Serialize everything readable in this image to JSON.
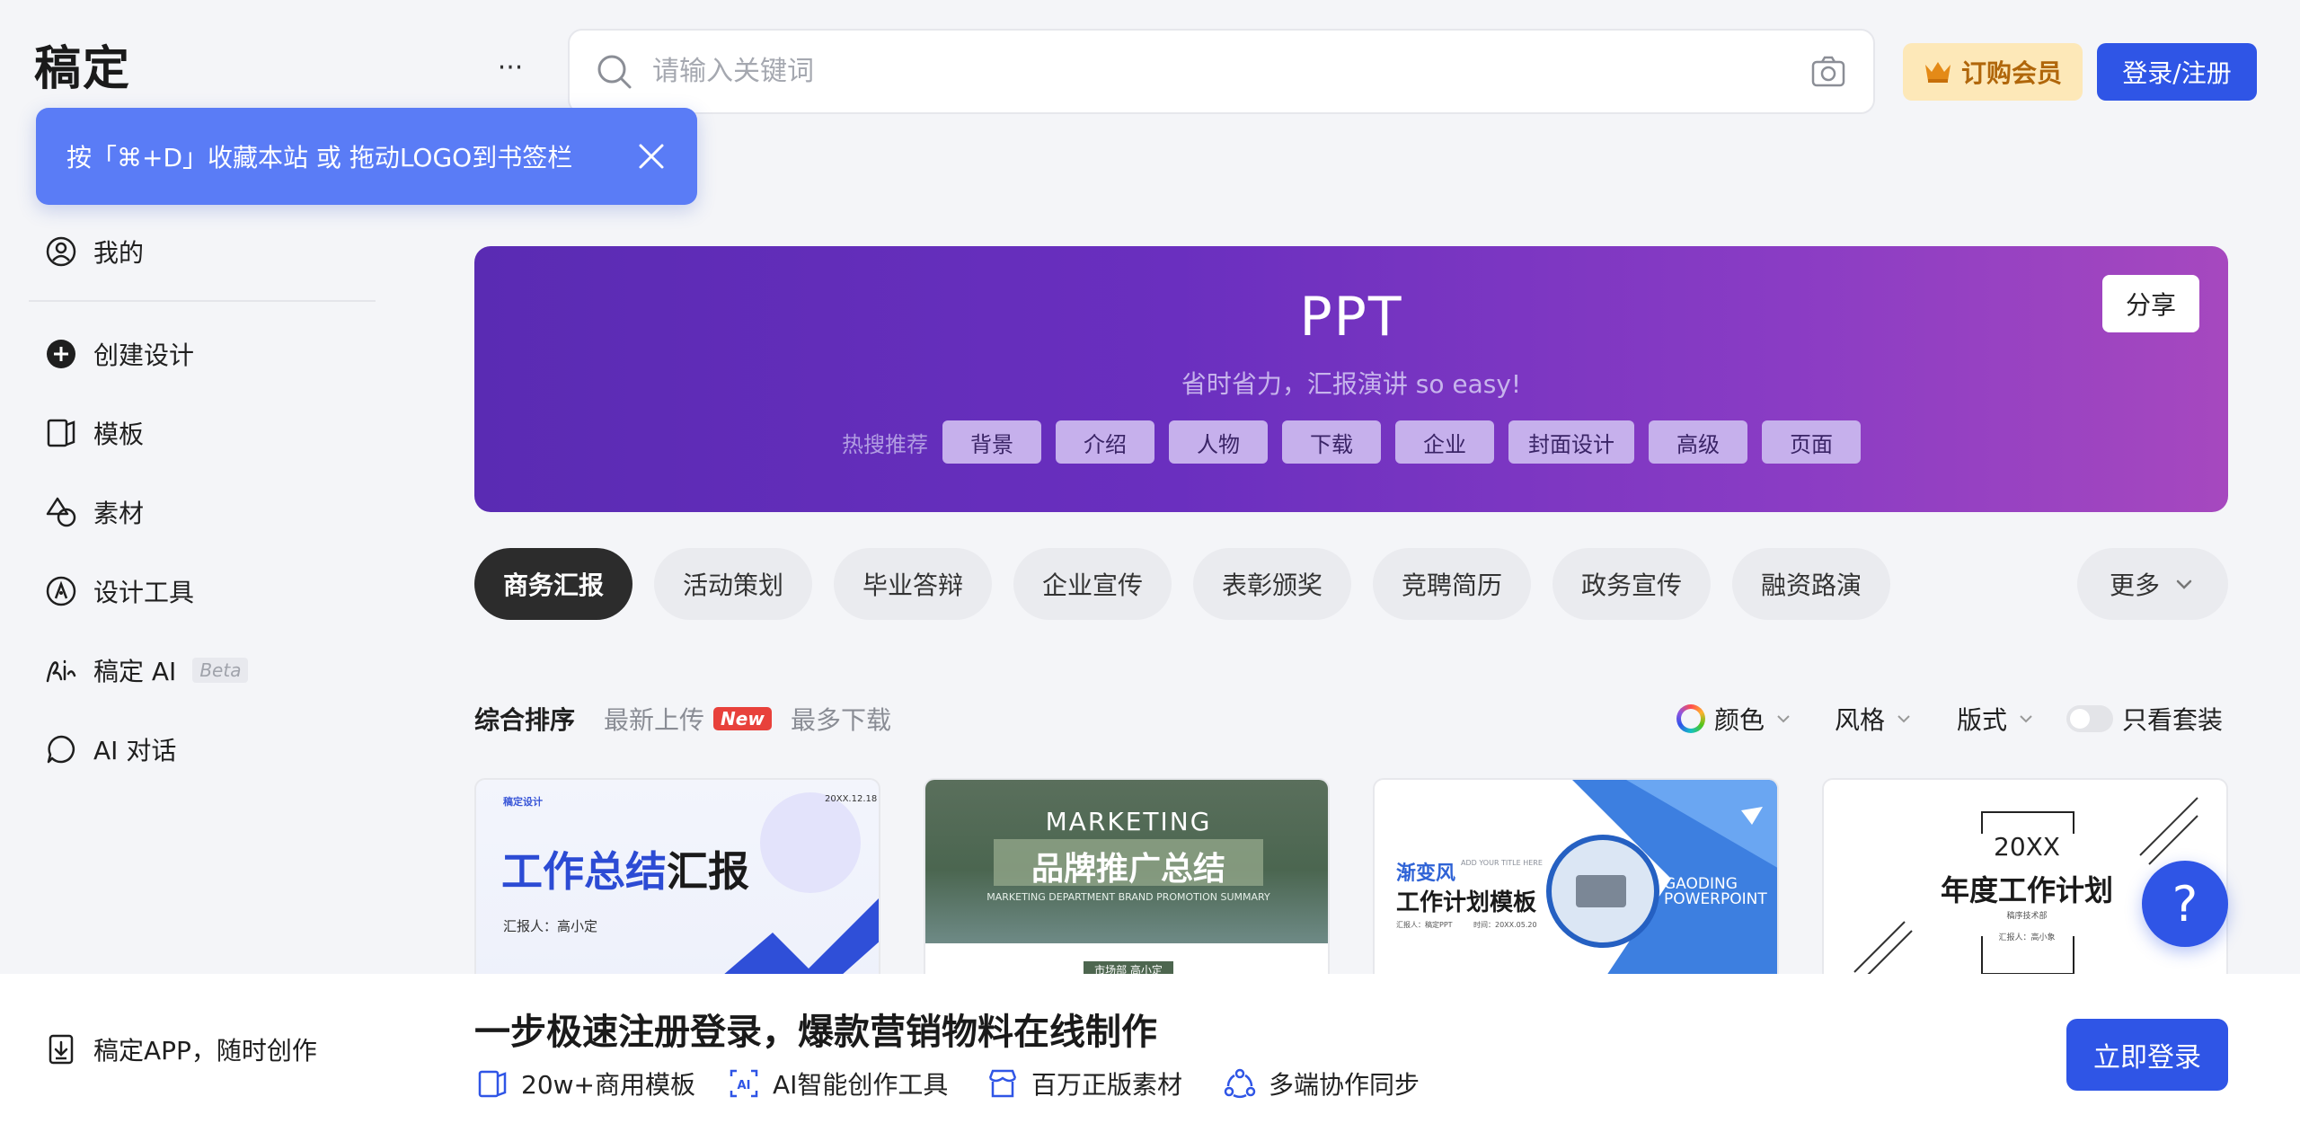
{
  "header": {
    "logo_text": "稿定",
    "more_label": "···",
    "search_placeholder": "请输入关键词",
    "vip_label": "订购会员",
    "login_label": "登录/注册"
  },
  "tooltip": {
    "text": "按「⌘+D」收藏本站 或 拖动LOGO到书签栏"
  },
  "sidebar": {
    "items": [
      {
        "label": "我的",
        "icon": "user-icon"
      },
      {
        "label": "创建设计",
        "icon": "plus-circle-icon"
      },
      {
        "label": "模板",
        "icon": "template-icon"
      },
      {
        "label": "素材",
        "icon": "shapes-icon"
      },
      {
        "label": "设计工具",
        "icon": "pen-tool-icon"
      },
      {
        "label": "稿定 AI",
        "icon": "ai-signature-icon",
        "badge": "Beta"
      },
      {
        "label": "AI 对话",
        "icon": "chat-bubble-icon"
      }
    ],
    "app_label": "稿定APP，随时创作"
  },
  "banner": {
    "title": "PPT",
    "subtitle": "省时省力，汇报演讲 so easy!",
    "hot_label": "热搜推荐",
    "hot_tags": [
      "背景",
      "介绍",
      "人物",
      "下载",
      "企业",
      "封面设计",
      "高级",
      "页面"
    ],
    "share_label": "分享",
    "gradient_start": "#5a2bb3",
    "gradient_end": "#a648bf"
  },
  "categories": {
    "items": [
      "商务汇报",
      "活动策划",
      "毕业答辩",
      "企业宣传",
      "表彰颁奖",
      "竞聘简历",
      "政务宣传",
      "融资路演"
    ],
    "active_index": 0,
    "more_label": "更多"
  },
  "sort": {
    "items": [
      "综合排序",
      "最新上传",
      "最多下载"
    ],
    "new_badge": "New",
    "active_index": 0
  },
  "filters": {
    "color_label": "颜色",
    "style_label": "风格",
    "layout_label": "版式",
    "toggle_label": "只看套装",
    "toggle_on": false
  },
  "cards": [
    {
      "brand": "稿定设计",
      "date": "20XX.12.18",
      "title_blue": "工作总结",
      "title_black": "汇报",
      "reporter": "汇报人：高小定"
    },
    {
      "eyebrow": "MARKETING",
      "title": "品牌推广总结",
      "subtitle": "MARKETING DEPARTMENT BRAND PROMOTION SUMMARY",
      "footer": "市场部 高小定"
    },
    {
      "title_accent": "渐变风",
      "title": "工作计划模板",
      "tagline": "ADD YOUR TITLE HERE",
      "reporter": "汇报人：稿定PPT",
      "date": "时间：20XX.05.20",
      "brand": "GAODING POWERPOINT"
    },
    {
      "year": "20XX",
      "title": "年度工作计划",
      "subtitle": "稿序技术部",
      "reporter": "汇报人：高小象"
    }
  ],
  "help": {
    "label": "?"
  },
  "bottom": {
    "headline": "一步极速注册登录，爆款营销物料在线制作",
    "features": [
      "20w+商用模板",
      "AI智能创作工具",
      "百万正版素材",
      "多端协作同步"
    ],
    "login_now_label": "立即登录"
  },
  "colors": {
    "primary": "#2f55e6",
    "tooltip_bg": "#5a7cf6",
    "vip_bg": "#fde8b8",
    "vip_text": "#b0660a",
    "new_badge": "#e8413b"
  }
}
